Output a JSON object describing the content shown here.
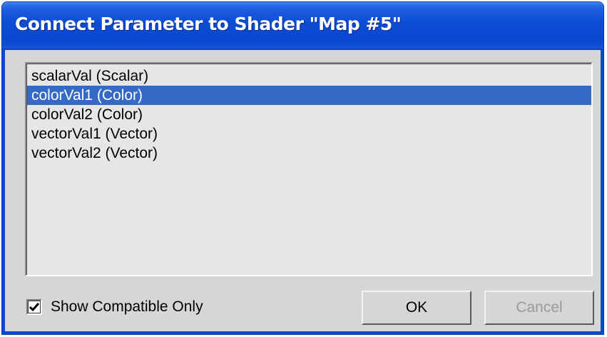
{
  "window": {
    "title": "Connect Parameter to Shader \"Map #5\""
  },
  "list": {
    "items": [
      {
        "label": "scalarVal (Scalar)",
        "selected": false
      },
      {
        "label": "colorVal1 (Color)",
        "selected": true
      },
      {
        "label": "colorVal2 (Color)",
        "selected": false
      },
      {
        "label": "vectorVal1 (Vector)",
        "selected": false
      },
      {
        "label": "vectorVal2 (Vector)",
        "selected": false
      }
    ]
  },
  "options": {
    "show_compatible_label": "Show Compatible Only",
    "show_compatible_checked": true
  },
  "buttons": {
    "ok_label": "OK",
    "cancel_label": "Cancel",
    "cancel_enabled": false
  },
  "colors": {
    "titlebar": "#0b4ad0",
    "selection": "#3569c5",
    "disabled_text": "#9a9a9a"
  },
  "icons": {
    "checkbox_mark": "checkmark-icon"
  }
}
